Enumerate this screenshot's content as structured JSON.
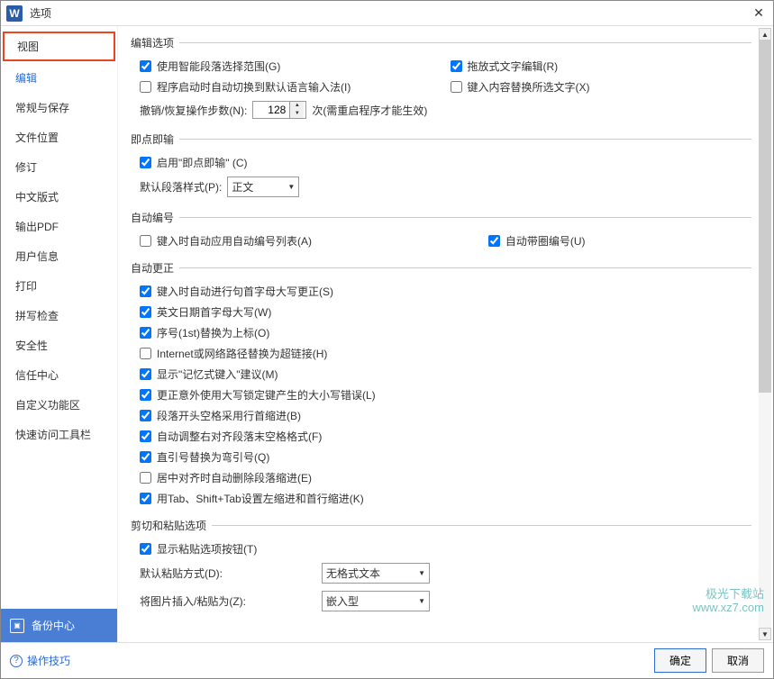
{
  "title": "选项",
  "sidebar": {
    "items": [
      {
        "label": "视图"
      },
      {
        "label": "编辑"
      },
      {
        "label": "常规与保存"
      },
      {
        "label": "文件位置"
      },
      {
        "label": "修订"
      },
      {
        "label": "中文版式"
      },
      {
        "label": "输出PDF"
      },
      {
        "label": "用户信息"
      },
      {
        "label": "打印"
      },
      {
        "label": "拼写检查"
      },
      {
        "label": "安全性"
      },
      {
        "label": "信任中心"
      },
      {
        "label": "自定义功能区"
      },
      {
        "label": "快速访问工具栏"
      }
    ],
    "backup": "备份中心"
  },
  "groups": {
    "edit_options": {
      "title": "编辑选项",
      "smart_select": "使用智能段落选择范围(G)",
      "drag_edit": "拖放式文字编辑(R)",
      "ime_switch": "程序启动时自动切换到默认语言输入法(I)",
      "replace_selected": "键入内容替换所选文字(X)",
      "undo_label": "撤销/恢复操作步数(N):",
      "undo_value": "128",
      "undo_note": "次(需重启程序才能生效)"
    },
    "click_type": {
      "title": "即点即输",
      "enable": "启用\"即点即输\" (C)",
      "default_style_label": "默认段落样式(P):",
      "default_style_value": "正文"
    },
    "auto_number": {
      "title": "自动编号",
      "apply_list": "键入时自动应用自动编号列表(A)",
      "circle_number": "自动带圈编号(U)"
    },
    "auto_correct": {
      "title": "自动更正",
      "first_letter": "键入时自动进行句首字母大写更正(S)",
      "en_date": "英文日期首字母大写(W)",
      "ordinal": "序号(1st)替换为上标(O)",
      "hyperlink": "Internet或网络路径替换为超链接(H)",
      "memory_type": "显示\"记忆式键入\"建议(M)",
      "caps_lock": "更正意外使用大写锁定键产生的大小写错误(L)",
      "space_indent": "段落开头空格采用行首缩进(B)",
      "adjust_spaces": "自动调整右对齐段落末空格格式(F)",
      "straight_quotes": "直引号替换为弯引号(Q)",
      "center_indent": "居中对齐时自动删除段落缩进(E)",
      "tab_indent": "用Tab、Shift+Tab设置左缩进和首行缩进(K)"
    },
    "cut_paste": {
      "title": "剪切和粘贴选项",
      "show_paste_btn": "显示粘贴选项按钮(T)",
      "default_paste_label": "默认粘贴方式(D):",
      "default_paste_value": "无格式文本",
      "image_paste_label": "将图片插入/粘贴为(Z):",
      "image_paste_value": "嵌入型"
    }
  },
  "footer": {
    "tips": "操作技巧",
    "ok": "确定",
    "cancel": "取消"
  },
  "watermark": {
    "line1": "极光下载站",
    "line2": "www.xz7.com"
  }
}
